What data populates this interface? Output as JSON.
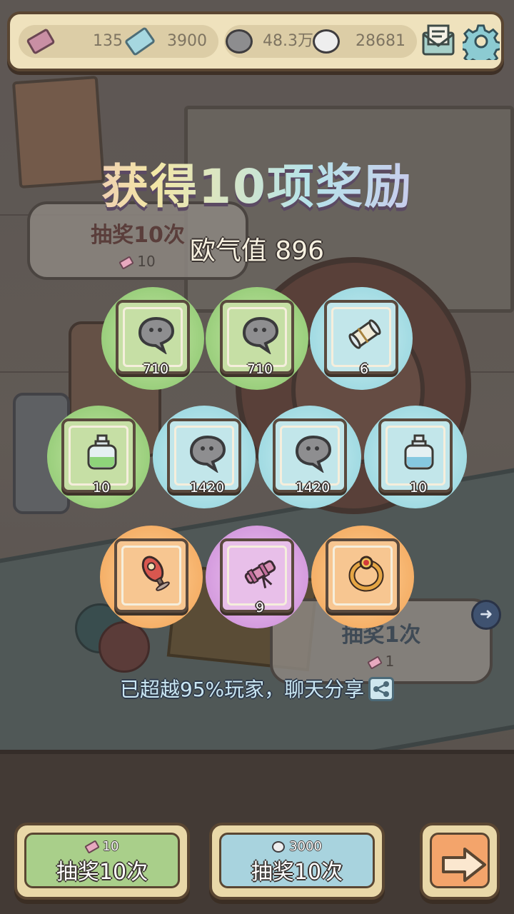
{
  "resources": {
    "tickets": "135",
    "gems": "3900",
    "dark_bubbles": "48.3万",
    "light_bubbles": "28681"
  },
  "title": "获得10项奖励",
  "luck_text": "欧气值 896",
  "background_panels": {
    "left_title": "抽奖10次",
    "left_cost": "10",
    "right_title": "抽奖1次",
    "right_cost": "1"
  },
  "rewards": [
    {
      "icon": "dark-speech-bubble",
      "qty": "710",
      "rarity": "green"
    },
    {
      "icon": "dark-speech-bubble",
      "qty": "710",
      "rarity": "green"
    },
    {
      "icon": "scroll",
      "qty": "6",
      "rarity": "teal"
    },
    {
      "icon": "green-potion-bottle",
      "qty": "10",
      "rarity": "green"
    },
    {
      "icon": "dark-speech-bubble",
      "qty": "1420",
      "rarity": "teal"
    },
    {
      "icon": "dark-speech-bubble",
      "qty": "1420",
      "rarity": "teal"
    },
    {
      "icon": "blue-potion-bottle",
      "qty": "10",
      "rarity": "teal"
    },
    {
      "icon": "rocket-flask",
      "qty": "",
      "rarity": "orange"
    },
    {
      "icon": "telescope",
      "qty": "9",
      "rarity": "purple"
    },
    {
      "icon": "ruby-ring",
      "qty": "",
      "rarity": "orange"
    }
  ],
  "share_text": "已超越95%玩家，聊天分享",
  "buttons": {
    "draw_ticket_cost": "10",
    "draw_ticket_label": "抽奖10次",
    "draw_bubble_cost": "3000",
    "draw_bubble_label": "抽奖10次"
  },
  "colors": {
    "green": "#86c46a",
    "teal": "#8fd2dc",
    "orange": "#f1a153",
    "purple": "#c98ad6",
    "panel": "#efe2bd"
  }
}
